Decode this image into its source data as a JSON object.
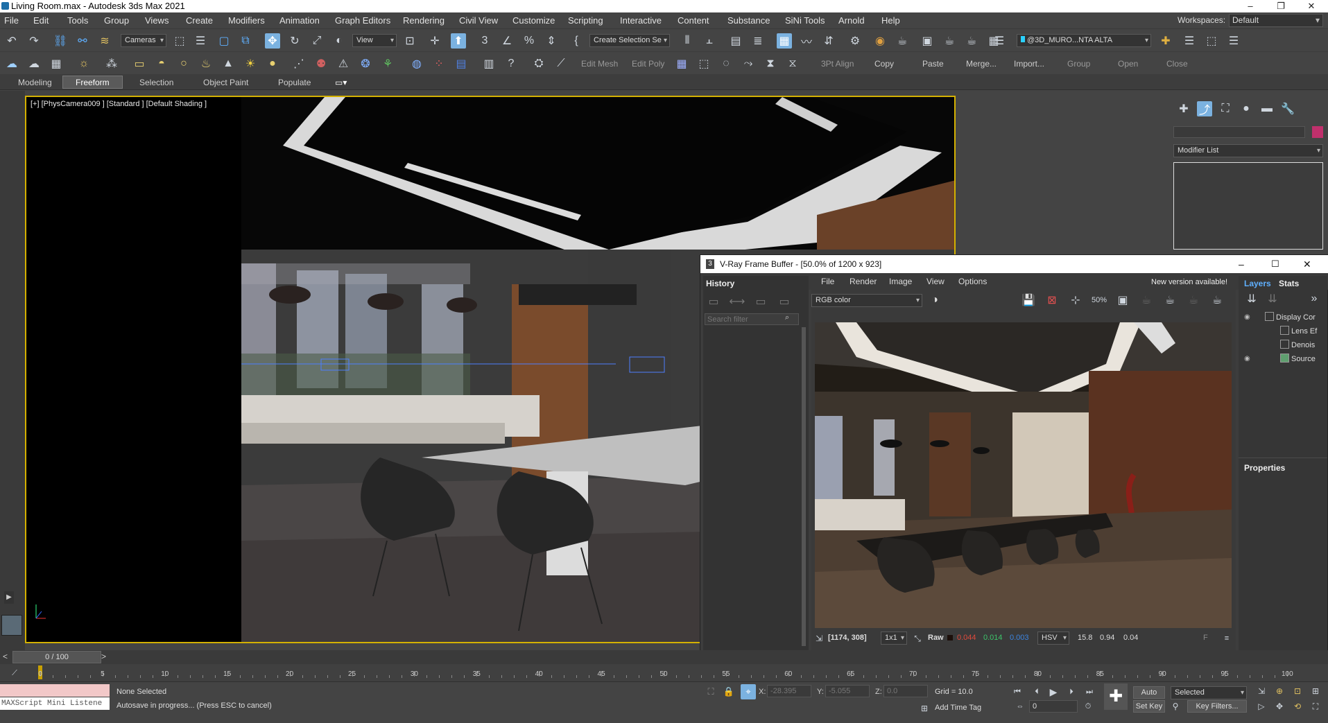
{
  "window": {
    "title": "Living Room.max - Autodesk 3ds Max 2021"
  },
  "menubar": {
    "items": [
      "File",
      "Edit",
      "Tools",
      "Group",
      "Views",
      "Create",
      "Modifiers",
      "Animation",
      "Graph Editors",
      "Rendering",
      "Civil View",
      "Customize",
      "Scripting",
      "Interactive",
      "Content",
      "Substance",
      "SiNi Tools",
      "Arnold",
      "Help"
    ],
    "workspace_label": "Workspaces:",
    "workspace_value": "Default"
  },
  "toolbar1": {
    "cameras_dropdown": "Cameras",
    "view_dropdown": "View",
    "selection_set": "Create Selection Se",
    "layer_dropdown": "@3D_MURO...NTA ALTA"
  },
  "toolbar2": {
    "items": [
      "Edit Mesh",
      "Edit Poly",
      "3Pt Align",
      "Copy",
      "Paste",
      "Merge...",
      "Import...",
      "Group",
      "Open",
      "Close"
    ]
  },
  "ribbon": {
    "tabs": [
      "Modeling",
      "Freeform",
      "Selection",
      "Object Paint",
      "Populate"
    ],
    "active": "Freeform"
  },
  "viewport": {
    "label": "[+] [PhysCamera009 ] [Standard ] [Default Shading ]"
  },
  "command_panel": {
    "modifier_list": "Modifier List"
  },
  "vfb": {
    "title": "V-Ray Frame Buffer - [50.0% of 1200 x 923]",
    "menu": [
      "File",
      "Render",
      "Image",
      "View",
      "Options"
    ],
    "notice": "New version available!",
    "history_label": "History",
    "search_placeholder": "Search filter",
    "channel": "RGB color",
    "tabs": [
      "Layers",
      "Stats"
    ],
    "layers": [
      "Display Cor",
      "Lens Ef",
      "Denois",
      "Source"
    ],
    "properties_label": "Properties",
    "coords": "[1174, 308]",
    "zoom_mode": "1x1",
    "raw_label": "Raw",
    "r": "0.044",
    "g": "0.014",
    "b": "0.003",
    "color_mode": "HSV",
    "h": "15.8",
    "s": "0.94",
    "v": "0.04",
    "f_label": "F"
  },
  "timeline": {
    "frame": "0 / 100",
    "ticks": [
      "0",
      "5",
      "10",
      "15",
      "20",
      "25",
      "30",
      "35",
      "40",
      "45",
      "50",
      "55",
      "60",
      "65",
      "70",
      "75",
      "80",
      "85",
      "90",
      "95",
      "100"
    ]
  },
  "status": {
    "selection": "None Selected",
    "message": "Autosave in progress... (Press ESC to cancel)",
    "maxscript": "MAXScript Mini Listene",
    "x_label": "X:",
    "x": "-28.395",
    "y_label": "Y:",
    "y": "-5.055",
    "z_label": "Z:",
    "z": "0.0",
    "grid": "Grid = 10.0",
    "add_time_tag": "Add Time Tag",
    "auto_key": "Auto Key",
    "set_key": "Set Key",
    "key_mode": "Selected",
    "key_filters": "Key Filters...",
    "frame_field": "0"
  },
  "colors": {
    "accent": "#7bb2e0",
    "viewport_border": "#d4b100",
    "r": "#e0493c",
    "g": "#3cc36a",
    "b": "#3b84e0"
  }
}
